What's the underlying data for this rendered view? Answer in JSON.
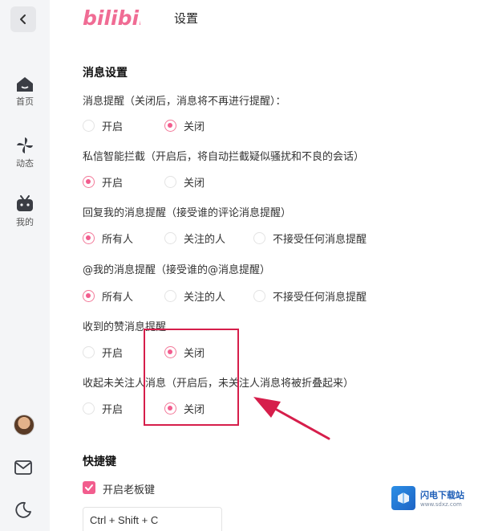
{
  "header": {
    "brand": "bilibili",
    "title": "设置"
  },
  "sidebar": {
    "items": [
      {
        "label": "首页",
        "icon": "home-icon"
      },
      {
        "label": "动态",
        "icon": "pinwheel-icon"
      },
      {
        "label": "我的",
        "icon": "tv-icon"
      }
    ],
    "bottom_icons": [
      "avatar",
      "mail-icon",
      "moon-icon"
    ]
  },
  "sections": {
    "messages": {
      "title": "消息设置"
    },
    "shortcuts": {
      "title": "快捷键"
    }
  },
  "settings": {
    "msg_remind": {
      "label": "消息提醒（关闭后，消息将不再进行提醒）：",
      "opt1": "开启",
      "opt2": "关闭",
      "selected": "关闭"
    },
    "dm_block": {
      "label": "私信智能拦截（开启后，将自动拦截疑似骚扰和不良的会话）",
      "opt1": "开启",
      "opt2": "关闭",
      "selected": "开启"
    },
    "reply_remind": {
      "label": "回复我的消息提醒（接受谁的评论消息提醒）",
      "opt1": "所有人",
      "opt2": "关注的人",
      "opt3": "不接受任何消息提醒",
      "selected": "所有人"
    },
    "at_remind": {
      "label": "@我的消息提醒（接受谁的@消息提醒）",
      "opt1": "所有人",
      "opt2": "关注的人",
      "opt3": "不接受任何消息提醒",
      "selected": "所有人"
    },
    "like_remind": {
      "label": "收到的赞消息提醒",
      "opt1": "开启",
      "opt2": "关闭",
      "selected": "关闭"
    },
    "fold_unfollowed": {
      "label": "收起未关注人消息（开启后，未关注人消息将被折叠起来）",
      "opt1": "开启",
      "opt2": "关闭",
      "selected": "关闭"
    }
  },
  "boss_key": {
    "label": "开启老板键",
    "checked": true,
    "shortcut": "Ctrl + Shift + C"
  },
  "watermark": {
    "title": "闪电下载站",
    "url": "www.sdxz.com"
  },
  "colors": {
    "accent": "#f25d8e",
    "annotation": "#d61e4b",
    "brand": "#f06c94"
  }
}
